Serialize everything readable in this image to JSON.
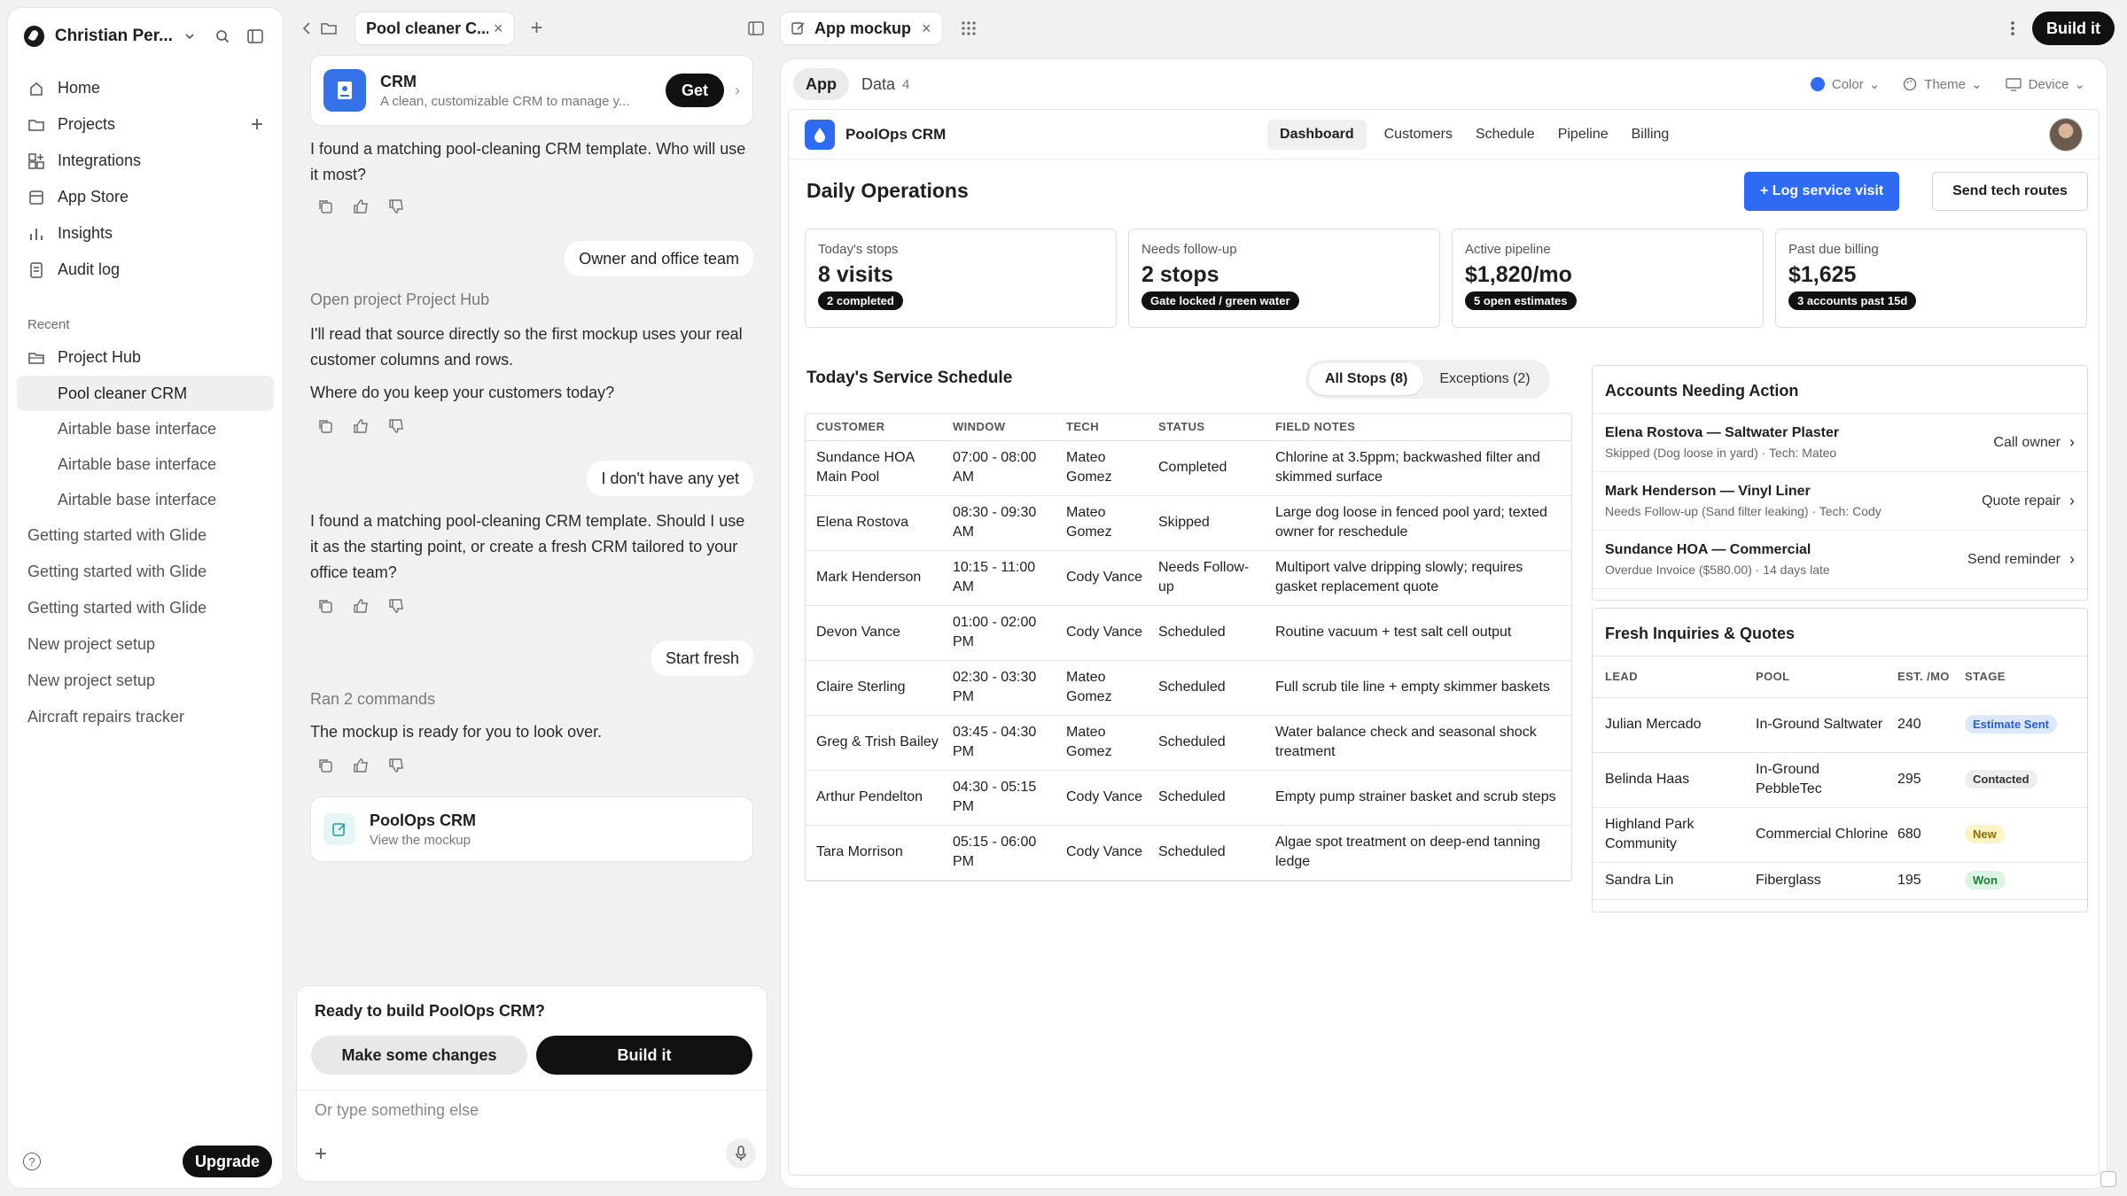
{
  "sidebar": {
    "workspace_name": "Christian Per...",
    "nav": [
      {
        "label": "Home",
        "icon": "home-icon"
      },
      {
        "label": "Projects",
        "icon": "folder-icon"
      },
      {
        "label": "Integrations",
        "icon": "integrations-icon"
      },
      {
        "label": "App Store",
        "icon": "store-icon"
      },
      {
        "label": "Insights",
        "icon": "insights-icon"
      },
      {
        "label": "Audit log",
        "icon": "audit-log-icon"
      }
    ],
    "recent_label": "Recent",
    "recent_project": "Project Hub",
    "recent_children": [
      "Pool cleaner CRM",
      "Airtable base interface",
      "Airtable base interface",
      "Airtable base interface"
    ],
    "recent_items": [
      "Getting started with Glide",
      "Getting started with Glide",
      "Getting started with Glide",
      "New project setup",
      "New project setup",
      "Aircraft repairs tracker"
    ],
    "upgrade_label": "Upgrade"
  },
  "chat": {
    "tab_title": "Pool cleaner C...",
    "template_card": {
      "title": "CRM",
      "subtitle": "A clean, customizable CRM to manage y...",
      "get_label": "Get"
    },
    "messages": [
      {
        "role": "assistant",
        "text": "I found a matching pool-cleaning CRM template. Who will use it most?"
      },
      {
        "role": "user",
        "text": "Owner and office team"
      },
      {
        "role": "status",
        "text": "Open project Project Hub"
      },
      {
        "role": "assistant",
        "text": "I'll read that source directly so the first mockup uses your real customer columns and rows."
      },
      {
        "role": "assistant",
        "text": "Where do you keep your customers today?"
      },
      {
        "role": "user",
        "text": "I don't have any yet"
      },
      {
        "role": "assistant",
        "text": "I found a matching pool-cleaning CRM template. Should I use it as the starting point, or create a fresh CRM tailored to your office team?"
      },
      {
        "role": "user",
        "text": "Start fresh"
      },
      {
        "role": "status",
        "text": "Ran 2 commands"
      },
      {
        "role": "assistant",
        "text": "The mockup is ready for you to look over."
      }
    ],
    "mockup_card": {
      "title": "PoolOps CRM",
      "subtitle": "View the mockup"
    },
    "prompt": {
      "question": "Ready to build PoolOps CRM?",
      "secondary": "Make some changes",
      "primary": "Build it"
    },
    "input_placeholder": "Or type something else"
  },
  "topbar": {
    "tab_title": "App mockup",
    "build_label": "Build it"
  },
  "preview_toolbar": {
    "tabs": [
      {
        "label": "App"
      },
      {
        "label": "Data",
        "count": "4"
      }
    ],
    "controls": [
      "Color",
      "Theme",
      "Device"
    ],
    "accent_color": "#2f6bf2"
  },
  "app": {
    "name": "PoolOps CRM",
    "nav": [
      "Dashboard",
      "Customers",
      "Schedule",
      "Pipeline",
      "Billing"
    ],
    "active_nav": "Dashboard",
    "page_title": "Daily Operations",
    "primary_action": "+ Log service visit",
    "secondary_action": "Send tech routes",
    "kpis": [
      {
        "label": "Today's stops",
        "value": "8 visits",
        "badge": "2 completed"
      },
      {
        "label": "Needs follow-up",
        "value": "2 stops",
        "badge": "Gate locked / green water"
      },
      {
        "label": "Active pipeline",
        "value": "$1,820/mo",
        "badge": "5 open estimates"
      },
      {
        "label": "Past due billing",
        "value": "$1,625",
        "badge": "3 accounts past 15d"
      }
    ],
    "schedule": {
      "title": "Today's Service Schedule",
      "filters": [
        "All Stops (8)",
        "Exceptions (2)"
      ],
      "columns": [
        "Customer",
        "Window",
        "Tech",
        "Status",
        "Field Notes"
      ],
      "rows": [
        [
          "Sundance HOA Main Pool",
          "07:00 - 08:00 AM",
          "Mateo Gomez",
          "Completed",
          "Chlorine at 3.5ppm; backwashed filter and skimmed surface"
        ],
        [
          "Elena Rostova",
          "08:30 - 09:30 AM",
          "Mateo Gomez",
          "Skipped",
          "Large dog loose in fenced pool yard; texted owner for reschedule"
        ],
        [
          "Mark Henderson",
          "10:15 - 11:00 AM",
          "Cody Vance",
          "Needs Follow-up",
          "Multiport valve dripping slowly; requires gasket replacement quote"
        ],
        [
          "Devon Vance",
          "01:00 - 02:00 PM",
          "Cody Vance",
          "Scheduled",
          "Routine vacuum + test salt cell output"
        ],
        [
          "Claire Sterling",
          "02:30 - 03:30 PM",
          "Mateo Gomez",
          "Scheduled",
          "Full scrub tile line + empty skimmer baskets"
        ],
        [
          "Greg & Trish Bailey",
          "03:45 - 04:30 PM",
          "Mateo Gomez",
          "Scheduled",
          "Water balance check and seasonal shock treatment"
        ],
        [
          "Arthur Pendelton",
          "04:30 - 05:15 PM",
          "Cody Vance",
          "Scheduled",
          "Empty pump strainer basket and scrub steps"
        ],
        [
          "Tara Morrison",
          "05:15 - 06:00 PM",
          "Cody Vance",
          "Scheduled",
          "Algae spot treatment on deep-end tanning ledge"
        ]
      ]
    },
    "accounts": {
      "title": "Accounts Needing Action",
      "items": [
        {
          "name": "Elena Rostova — Saltwater Plaster",
          "detail": "Skipped (Dog loose in yard) · Tech: Mateo",
          "action": "Call owner"
        },
        {
          "name": "Mark Henderson — Vinyl Liner",
          "detail": "Needs Follow-up (Sand filter leaking) · Tech: Cody",
          "action": "Quote repair"
        },
        {
          "name": "Sundance HOA — Commercial",
          "detail": "Overdue Invoice ($580.00) · 14 days late",
          "action": "Send reminder"
        }
      ]
    },
    "inquiries": {
      "title": "Fresh Inquiries & Quotes",
      "columns": [
        "Lead",
        "Pool",
        "Est. /Mo",
        "Stage"
      ],
      "rows": [
        {
          "lead": "Julian Mercado",
          "pool": "In-Ground Saltwater",
          "est": "240",
          "stage": "Estimate Sent",
          "color": "#dbe8ff",
          "text": "#2a5bd7"
        },
        {
          "lead": "Belinda Haas",
          "pool": "In-Ground PebbleTec",
          "est": "295",
          "stage": "Contacted",
          "color": "#eeeeee",
          "text": "#333333"
        },
        {
          "lead": "Highland Park Community",
          "pool": "Commercial Chlorine",
          "est": "680",
          "stage": "New",
          "color": "#fdf3c4",
          "text": "#8a6a00"
        },
        {
          "lead": "Sandra Lin",
          "pool": "Fiberglass",
          "est": "195",
          "stage": "Won",
          "color": "#dcf5e3",
          "text": "#1d7a3a"
        }
      ]
    }
  }
}
